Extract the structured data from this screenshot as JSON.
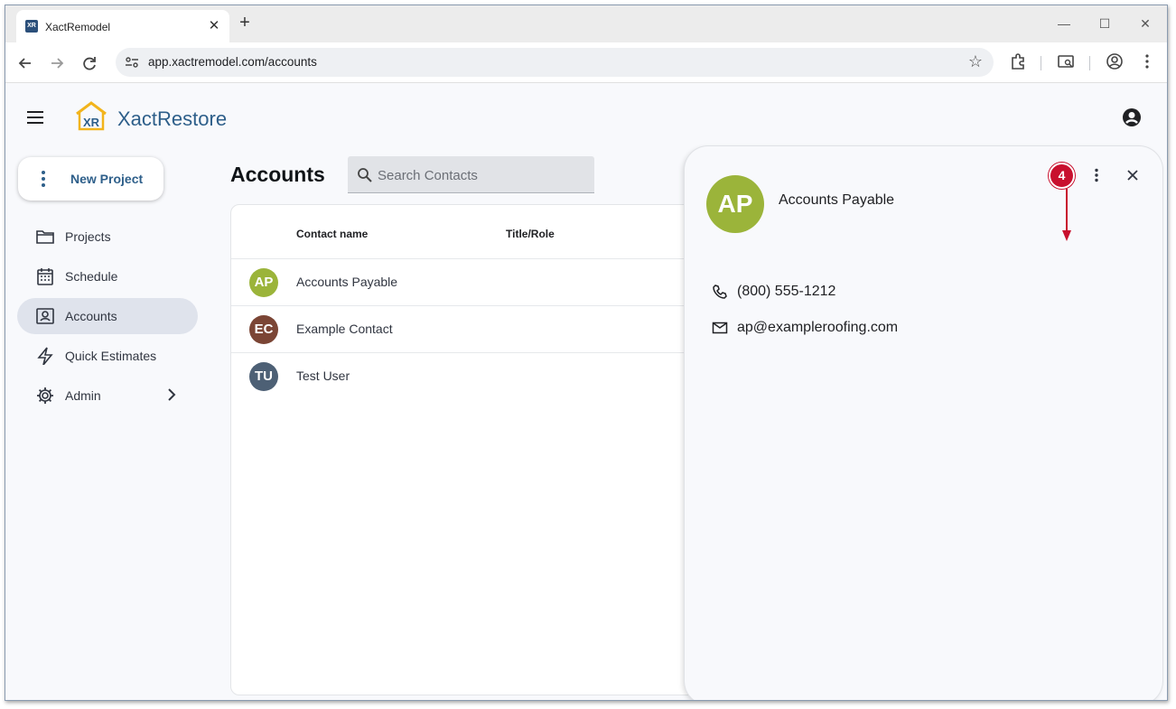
{
  "browser": {
    "tab_title": "XactRemodel",
    "favicon_text": "XR",
    "url": "app.xactremodel.com/accounts"
  },
  "app": {
    "brand": "XactRestore",
    "logo_text": "XR",
    "new_project_label": "New Project",
    "nav": [
      {
        "label": "Projects",
        "icon": "folder-icon"
      },
      {
        "label": "Schedule",
        "icon": "calendar-icon"
      },
      {
        "label": "Accounts",
        "icon": "contacts-icon",
        "active": true
      },
      {
        "label": "Quick Estimates",
        "icon": "lightning-icon"
      },
      {
        "label": "Admin",
        "icon": "gear-icon"
      }
    ]
  },
  "main": {
    "title": "Accounts",
    "search_placeholder": "Search Contacts",
    "columns": [
      "Contact name",
      "Title/Role"
    ],
    "rows": [
      {
        "initials": "AP",
        "name": "Accounts Payable",
        "color": "#9bb43a"
      },
      {
        "initials": "EC",
        "name": "Example Contact",
        "color": "#7b4535"
      },
      {
        "initials": "TU",
        "name": "Test User",
        "color": "#4d6075"
      }
    ]
  },
  "panel": {
    "initials": "AP",
    "name": "Accounts Payable",
    "avatar_color": "#9bb43a",
    "phone": "(800) 555-1212",
    "email": "ap@exampleroofing.com"
  },
  "callout": {
    "number": "4",
    "color": "#c8102e"
  }
}
